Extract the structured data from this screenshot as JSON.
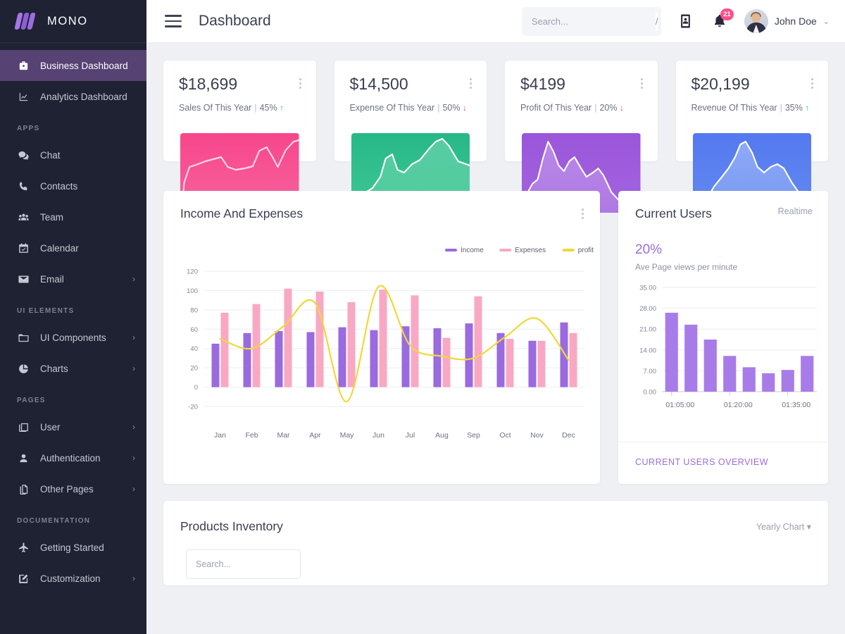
{
  "brand": {
    "name": "MONO",
    "logo_icon": "mono-logo-icon"
  },
  "sidebar": {
    "items": [
      {
        "label": "Business Dashboard",
        "icon": "briefcase-icon",
        "active": true,
        "chevron": false,
        "section": null
      },
      {
        "label": "Analytics Dashboard",
        "icon": "chart-line-icon",
        "active": false,
        "chevron": false,
        "section": null
      },
      {
        "label": "APPS",
        "type": "section"
      },
      {
        "label": "Chat",
        "icon": "chat-bubbles-icon",
        "active": false,
        "chevron": false
      },
      {
        "label": "Contacts",
        "icon": "phone-icon",
        "active": false,
        "chevron": false
      },
      {
        "label": "Team",
        "icon": "people-icon",
        "active": false,
        "chevron": false
      },
      {
        "label": "Calendar",
        "icon": "calendar-icon",
        "active": false,
        "chevron": false
      },
      {
        "label": "Email",
        "icon": "envelope-icon",
        "active": false,
        "chevron": true
      },
      {
        "label": "UI ELEMENTS",
        "type": "section"
      },
      {
        "label": "UI Components",
        "icon": "folder-icon",
        "active": false,
        "chevron": true
      },
      {
        "label": "Charts",
        "icon": "pie-chart-icon",
        "active": false,
        "chevron": true
      },
      {
        "label": "PAGES",
        "type": "section"
      },
      {
        "label": "User",
        "icon": "window-stack-icon",
        "active": false,
        "chevron": true
      },
      {
        "label": "Authentication",
        "icon": "person-icon",
        "active": false,
        "chevron": true
      },
      {
        "label": "Other Pages",
        "icon": "pages-icon",
        "active": false,
        "chevron": true
      },
      {
        "label": "DOCUMENTATION",
        "type": "section"
      },
      {
        "label": "Getting Started",
        "icon": "airplane-icon",
        "active": false,
        "chevron": false
      },
      {
        "label": "Customization",
        "icon": "edit-square-icon",
        "active": false,
        "chevron": true
      }
    ],
    "chevron_glyph": "›"
  },
  "header": {
    "menu_icon": "hamburger-menu-icon",
    "title": "Dashboard",
    "search": {
      "placeholder": "Search...",
      "value": "",
      "shortcut": "/"
    },
    "contact_icon": "contact-card-icon",
    "bell_icon": "bell-icon",
    "notification_count": "21",
    "user_name": "John Doe",
    "caret_glyph": "⌄"
  },
  "stats": [
    {
      "value": "$18,699",
      "label": "Sales Of This Year",
      "percent": "45%",
      "direction": "up",
      "arrow": "↑",
      "color": "#f74d8f",
      "menu_icon": "kebab-menu-icon"
    },
    {
      "value": "$14,500",
      "label": "Expense Of This Year",
      "percent": "50%",
      "direction": "down",
      "arrow": "↓",
      "color": "#2ec08a",
      "menu_icon": "kebab-menu-icon"
    },
    {
      "value": "$4199",
      "label": "Profit Of This Year",
      "percent": "20%",
      "direction": "down",
      "arrow": "↓",
      "color": "#9a5cd8",
      "menu_icon": "kebab-menu-icon"
    },
    {
      "value": "$20,199",
      "label": "Revenue Of This Year",
      "percent": "35%",
      "direction": "up",
      "arrow": "↑",
      "color": "#5b85ef",
      "menu_icon": "kebab-menu-icon"
    }
  ],
  "income_panel": {
    "title": "Income And Expenses",
    "menu_icon": "kebab-menu-icon"
  },
  "users_panel": {
    "title": "Current Users",
    "note": "Realtime",
    "percent": "20%",
    "caption": "Ave Page views per minute",
    "footer_link": "CURRENT USERS OVERVIEW"
  },
  "products_panel": {
    "title": "Products Inventory",
    "select_label": "Yearly Chart",
    "select_caret": "▾",
    "search": {
      "placeholder": "Search...",
      "value": ""
    }
  },
  "colors": {
    "sidebar_bg": "#1f2232",
    "active_item": "#564273",
    "accent_purple": "#9b6ce2",
    "income_bar": "#9a6ae0",
    "expenses_bar": "#f9a8c4",
    "profit_line": "#f0d838",
    "badge_pink": "#ff4f8b",
    "positive": "#26c38a",
    "negative": "#f5455c",
    "page_bg": "#eef0f4"
  },
  "chart_data": [
    {
      "type": "bar",
      "id": "income-and-expenses",
      "title": "Income And Expenses",
      "categories": [
        "Jan",
        "Feb",
        "Mar",
        "Apr",
        "May",
        "Jun",
        "Jul",
        "Aug",
        "Sep",
        "Oct",
        "Nov",
        "Dec"
      ],
      "series": [
        {
          "name": "Income",
          "type": "bar",
          "color": "#9a6ae0",
          "values": [
            45,
            56,
            58,
            57,
            62,
            59,
            63,
            61,
            66,
            56,
            48,
            67
          ]
        },
        {
          "name": "Expenses",
          "type": "bar",
          "color": "#f9a8c4",
          "values": [
            77,
            86,
            102,
            99,
            88,
            101,
            95,
            51,
            94,
            50,
            48,
            56
          ]
        },
        {
          "name": "profit",
          "type": "line",
          "color": "#f0d838",
          "values": [
            50,
            40,
            63,
            87,
            -15,
            104,
            43,
            32,
            30,
            52,
            71,
            28
          ]
        }
      ],
      "ylim": [
        -20,
        120
      ],
      "yticks": [
        -20,
        0,
        20,
        40,
        60,
        80,
        100,
        120
      ],
      "xlabel": "",
      "ylabel": "",
      "grid": true,
      "legend": {
        "position": "top-right",
        "entries": [
          "Income",
          "Expenses",
          "profit"
        ]
      }
    },
    {
      "type": "bar",
      "id": "current-users",
      "title": "Current Users",
      "categories": [
        "01:05:00",
        "",
        "",
        "01:20:00",
        "",
        "",
        "01:35:00",
        ""
      ],
      "xtick_labels": [
        "01:05:00",
        "01:20:00",
        "01:35:00"
      ],
      "values": [
        26.5,
        22.5,
        17.5,
        12.0,
        8.2,
        6.2,
        7.3,
        12.0
      ],
      "color": "#a87ce8",
      "ylim": [
        0,
        35
      ],
      "yticks": [
        "0.00",
        "7.00",
        "14.00",
        "21.00",
        "28.00",
        "35.00"
      ],
      "xlabel": "",
      "ylabel": "",
      "grid": true,
      "legend": {
        "position": "none",
        "entries": []
      }
    }
  ]
}
